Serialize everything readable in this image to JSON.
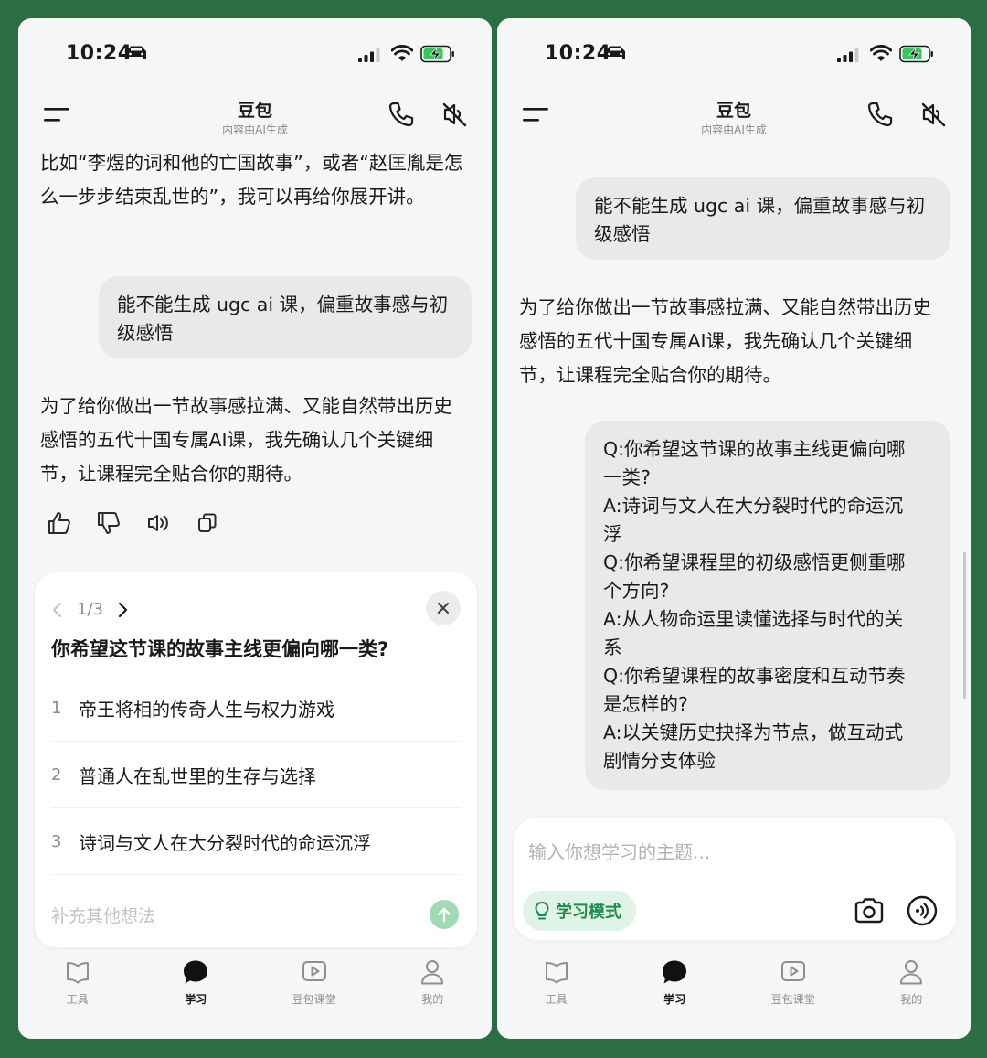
{
  "status_bar": {
    "time": "10:24"
  },
  "header": {
    "title": "豆包",
    "subtitle": "内容由AI生成"
  },
  "left": {
    "ai_text_top": "比如“李煜的词和他的亡国故事”，或者“赵匡胤是怎么一步步结束乱世的”，我可以再给你展开讲。",
    "user_message": "能不能生成 ugc ai 课，偏重故事感与初级感悟",
    "ai_reply": "为了给你做出一节故事感拉满、又能自然带出历史感悟的五代十国专属AI课，我先确认几个关键细节，让课程完全贴合你的期待。",
    "question_card": {
      "page": "1/3",
      "question": "你希望这节课的故事主线更偏向哪一类?",
      "options": [
        {
          "num": "1",
          "text": "帝王将相的传奇人生与权力游戏"
        },
        {
          "num": "2",
          "text": "普通人在乱世里的生存与选择"
        },
        {
          "num": "3",
          "text": "诗词与文人在大分裂时代的命运沉浮"
        }
      ],
      "input_placeholder": "补充其他想法"
    }
  },
  "right": {
    "user_message": "能不能生成 ugc ai 课，偏重故事感与初级感悟",
    "ai_reply": "为了给你做出一节故事感拉满、又能自然带出历史感悟的五代十国专属AI课，我先确认几个关键细节，让课程完全贴合你的期待。",
    "answers_lines": [
      "Q:你希望这节课的故事主线更偏向哪",
      "一类?",
      "A:诗词与文人在大分裂时代的命运沉",
      "浮",
      "Q:你希望课程里的初级感悟更侧重哪",
      "个方向?",
      "A:从人物命运里读懂选择与时代的关",
      "系",
      "Q:你希望课程的故事密度和互动节奏",
      "是怎样的?",
      "A:以关键历史抉择为节点，做互动式",
      "剧情分支体验"
    ],
    "input_placeholder": "输入你想学习的主题...",
    "study_mode_label": "学习模式"
  },
  "bottom_nav": [
    {
      "label": "工具",
      "icon": "book-icon"
    },
    {
      "label": "学习",
      "icon": "chat-bubble-icon",
      "active": true
    },
    {
      "label": "豆包课堂",
      "icon": "play-icon"
    },
    {
      "label": "我的",
      "icon": "person-icon"
    }
  ],
  "colors": {
    "frame": "#2c6e44",
    "accent": "#1f8b4c",
    "send": "#9fdcb6",
    "bubble": "#e9e9e9"
  }
}
